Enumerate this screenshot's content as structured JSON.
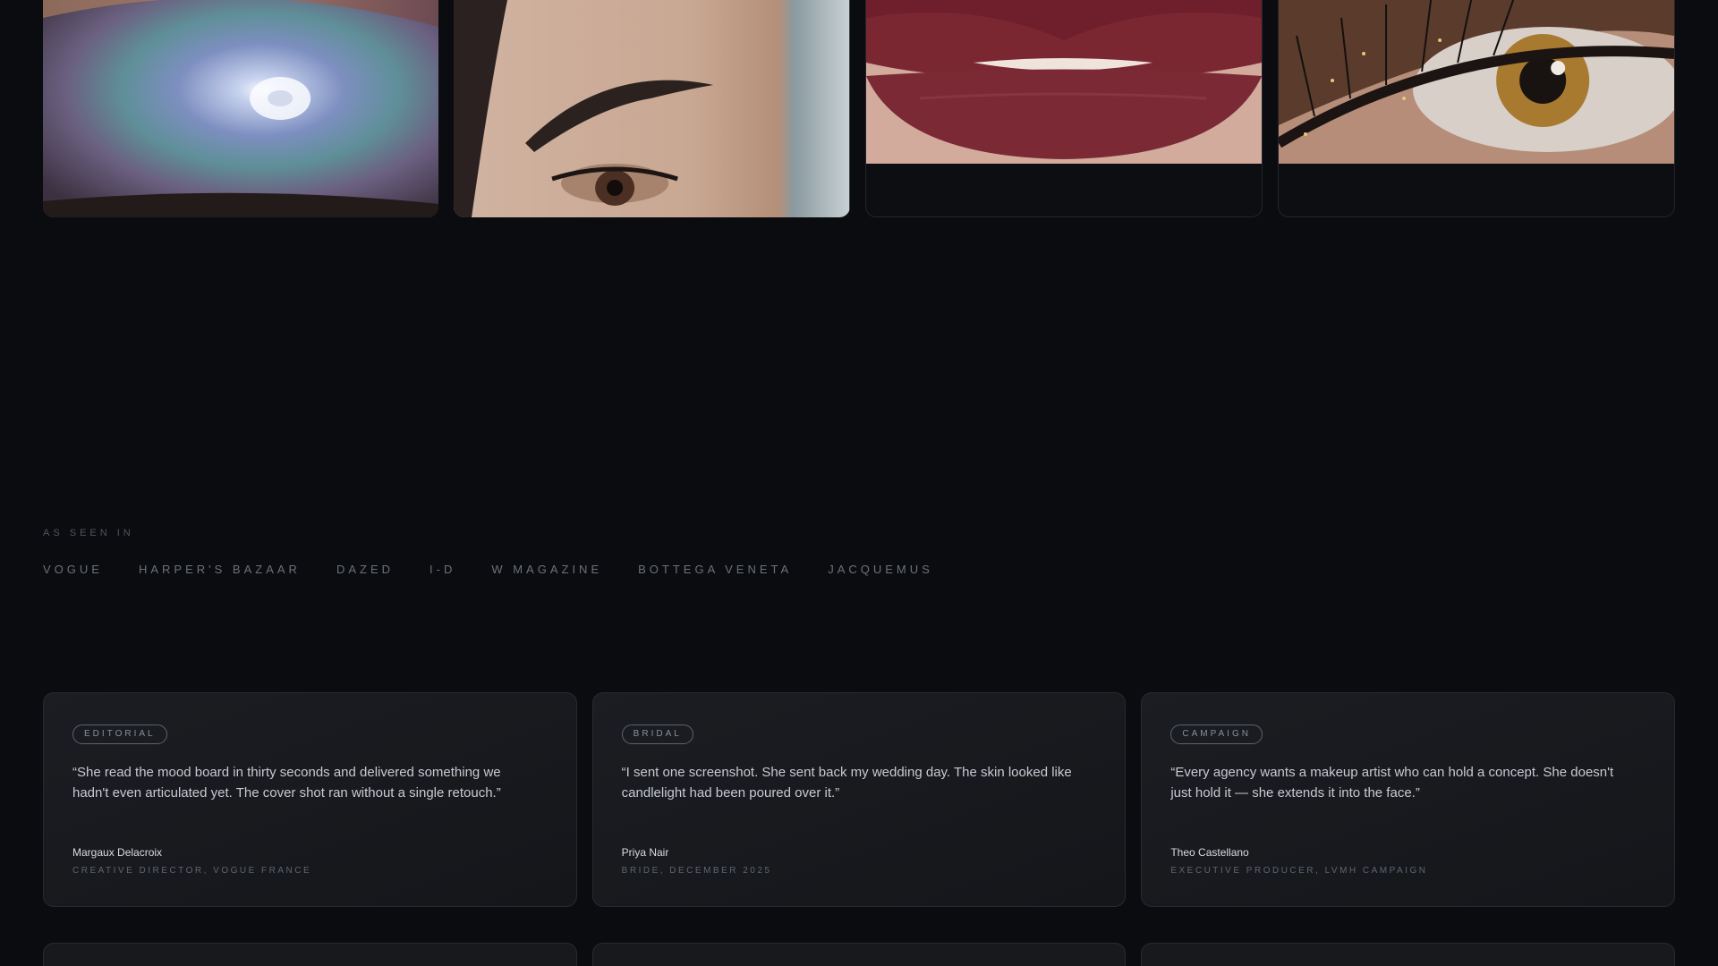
{
  "gallery": {
    "tiles": [
      {
        "name": "iridescent-eyeshadow"
      },
      {
        "name": "brow-portrait"
      },
      {
        "name": "matte-lips"
      },
      {
        "name": "glitter-lashes"
      }
    ]
  },
  "press": {
    "label": "AS SEEN IN",
    "items": [
      "VOGUE",
      "HARPER'S BAZAAR",
      "DAZED",
      "I-D",
      "W MAGAZINE",
      "BOTTEGA VENETA",
      "JACQUEMUS"
    ]
  },
  "testimonials": [
    {
      "tag": "EDITORIAL",
      "quote": "“She read the mood board in thirty seconds and delivered something we hadn't even articulated yet. The cover shot ran without a single retouch.”",
      "author": "Margaux Delacroix",
      "role": "CREATIVE DIRECTOR, VOGUE FRANCE"
    },
    {
      "tag": "BRIDAL",
      "quote": "“I sent one screenshot. She sent back my wedding day. The skin looked like candlelight had been poured over it.”",
      "author": "Priya Nair",
      "role": "BRIDE, DECEMBER 2025"
    },
    {
      "tag": "CAMPAIGN",
      "quote": "“Every agency wants a makeup artist who can hold a concept. She doesn't just hold it — she extends it into the face.”",
      "author": "Theo Castellano",
      "role": "EXECUTIVE PRODUCER, LVMH CAMPAIGN"
    }
  ]
}
